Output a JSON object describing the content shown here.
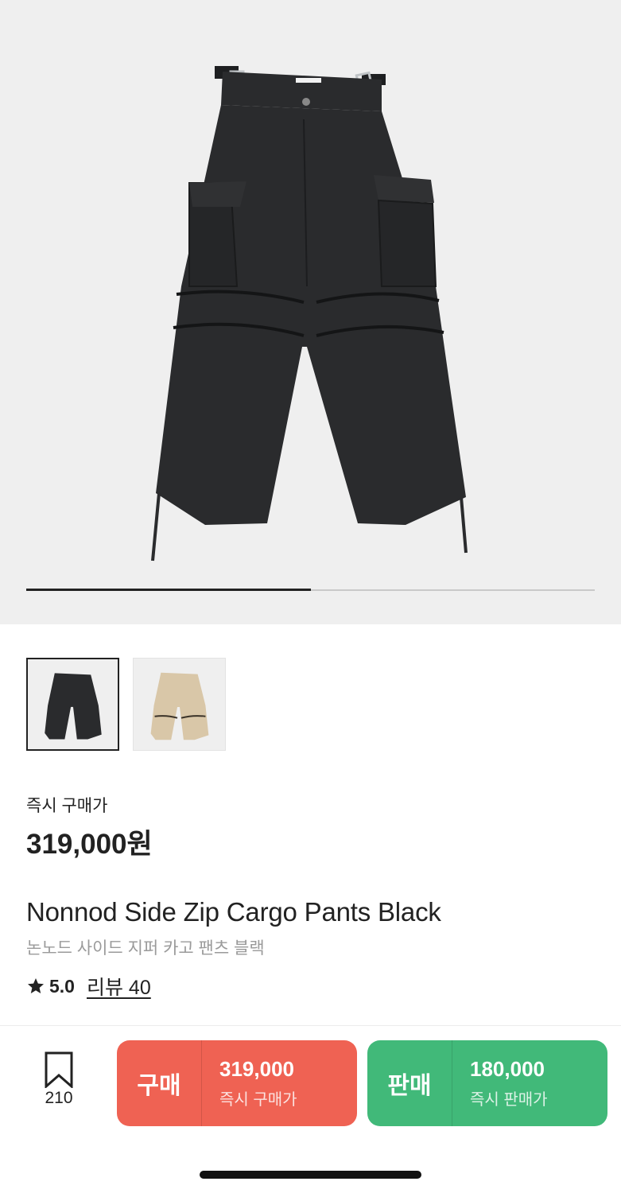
{
  "gallery": {
    "progress_fraction": 0.5
  },
  "thumbnails": [
    {
      "name": "black-pants-thumbnail",
      "color": "#2a2b2d",
      "selected": true
    },
    {
      "name": "beige-pants-thumbnail",
      "color": "#d9c7a8",
      "selected": false
    }
  ],
  "price": {
    "label": "즉시 구매가",
    "value": "319,000원"
  },
  "product": {
    "name_en": "Nonnod Side Zip Cargo Pants Black",
    "name_ko": "논노드 사이드 지퍼 카고 팬츠 블랙"
  },
  "rating": {
    "score": "5.0",
    "review_link": "리뷰 40"
  },
  "bottom_bar": {
    "bookmark_icon": "bookmark-icon",
    "bookmark_count": "210",
    "buy": {
      "label": "구매",
      "price": "319,000",
      "sub": "즉시 구매가",
      "color": "#ef6253"
    },
    "sell": {
      "label": "판매",
      "price": "180,000",
      "sub": "즉시 판매가",
      "color": "#41b979"
    }
  }
}
